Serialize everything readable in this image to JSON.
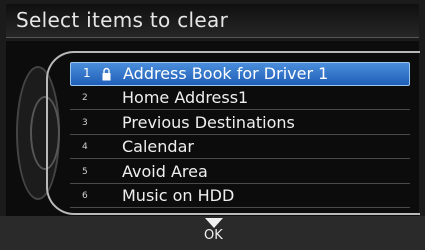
{
  "header": {
    "title": "Select items to clear"
  },
  "items": [
    {
      "number": "1",
      "label": "Address Book for Driver 1",
      "selected": true,
      "icon": "lock-icon"
    },
    {
      "number": "2",
      "label": "Home Address1"
    },
    {
      "number": "3",
      "label": "Previous Destinations"
    },
    {
      "number": "4",
      "label": "Calendar"
    },
    {
      "number": "5",
      "label": "Avoid Area"
    },
    {
      "number": "6",
      "label": "Music on HDD"
    }
  ],
  "footer": {
    "ok_label": "OK"
  },
  "colors": {
    "selection": "#2f75c9",
    "background": "#0c0c0c"
  }
}
